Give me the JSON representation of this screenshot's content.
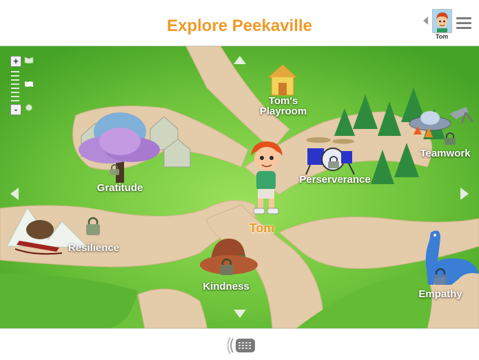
{
  "header": {
    "title": "Explore Peekaville",
    "profile_name": "Tom"
  },
  "map": {
    "locations": [
      {
        "id": "playroom",
        "label": "Tom's\nPlayroom",
        "locked": false
      },
      {
        "id": "gratitude",
        "label": "Gratitude",
        "locked": true
      },
      {
        "id": "perseverance",
        "label": "Perserverance",
        "locked": true
      },
      {
        "id": "teamwork",
        "label": "Teamwork",
        "locked": true
      },
      {
        "id": "resilience",
        "label": "Resilience",
        "locked": true
      },
      {
        "id": "kindness",
        "label": "Kindness",
        "locked": true
      },
      {
        "id": "empathy",
        "label": "Empathy",
        "locked": true
      }
    ],
    "character_label": "Tom"
  },
  "zoom": {
    "plus": "+",
    "minus": "-"
  },
  "colors": {
    "title": "#ef9a26",
    "grass": "#6cc23a",
    "path": "#e2c9a8",
    "character_label": "#f29a1c"
  },
  "icons": {
    "menu": "hamburger-menu-icon",
    "speech": "speech-bubble-icon",
    "lock": "padlock-icon",
    "nav": "triangle-arrow-icon"
  }
}
